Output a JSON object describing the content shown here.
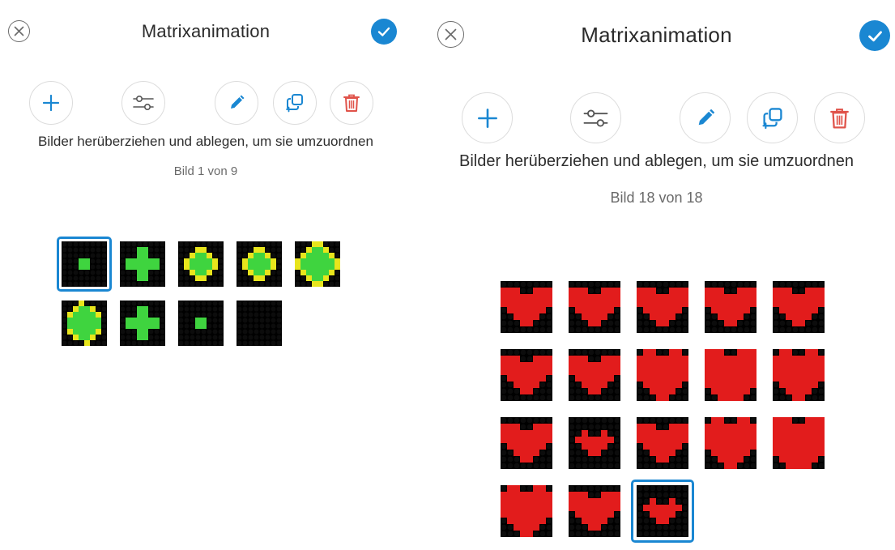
{
  "screens": [
    {
      "title": "Matrixanimation",
      "instruction": "Bilder herüberziehen und ablegen, um sie umzuordnen",
      "counter": "Bild 1 von 9",
      "toolbar": {
        "icons": [
          "plus-icon",
          "sliders-icon",
          "pencil-icon",
          "duplicate-icon",
          "trash-icon"
        ]
      },
      "selected_frame": 1,
      "frame_count": 9,
      "frames": [
        {
          "pattern": "plus-small"
        },
        {
          "pattern": "diamond-medium"
        },
        {
          "pattern": "plus-medium-yellow-tips"
        },
        {
          "pattern": "plus-medium-yellow-tips"
        },
        {
          "pattern": "plus-large-yellow-tips"
        },
        {
          "pattern": "diamond-large-yellow-tips"
        },
        {
          "pattern": "diamond-medium"
        },
        {
          "pattern": "dot-small"
        },
        {
          "pattern": "empty"
        }
      ]
    },
    {
      "title": "Matrixanimation",
      "instruction": "Bilder herüberziehen und ablegen, um sie umzuordnen",
      "counter": "Bild 18 von 18",
      "toolbar": {
        "icons": [
          "plus-icon",
          "sliders-icon",
          "pencil-icon",
          "duplicate-icon",
          "trash-icon"
        ]
      },
      "selected_frame": 18,
      "frame_count": 18,
      "frames": [
        {
          "pattern": "heart"
        },
        {
          "pattern": "heart"
        },
        {
          "pattern": "heart"
        },
        {
          "pattern": "heart"
        },
        {
          "pattern": "heart"
        },
        {
          "pattern": "heart"
        },
        {
          "pattern": "heart"
        },
        {
          "pattern": "heart-large"
        },
        {
          "pattern": "heart-full"
        },
        {
          "pattern": "heart-large"
        },
        {
          "pattern": "heart"
        },
        {
          "pattern": "heart-small"
        },
        {
          "pattern": "heart"
        },
        {
          "pattern": "heart-large"
        },
        {
          "pattern": "heart-full"
        },
        {
          "pattern": "heart-large"
        },
        {
          "pattern": "heart"
        },
        {
          "pattern": "heart-small"
        }
      ]
    }
  ],
  "colors": {
    "accent": "#1a87d2",
    "led_off": "#111111",
    "led_frame": "#000000",
    "green": "#3fd43f",
    "yellow": "#e8e51c",
    "red": "#e21c1c",
    "trash": "#e0534a",
    "gray_icon": "#6b6b6b"
  }
}
